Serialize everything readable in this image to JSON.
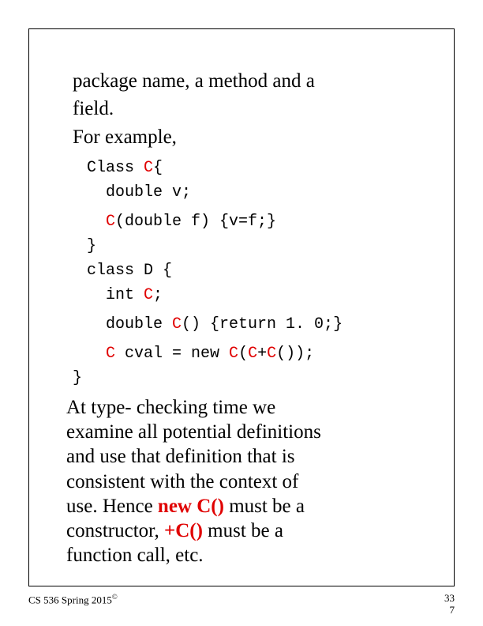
{
  "para1_line1": "package name, a method and a",
  "para1_line2": "field.",
  "para1_line3": "For example,",
  "code": {
    "l1a": "Class ",
    "l1b": "C",
    "l1c": "{",
    "l2": "double v;",
    "l3a": "C",
    "l3b": "(double f) {v=f;}",
    "l4": "}",
    "l5": "class D {",
    "l6a": "int ",
    "l6b": "C",
    "l6c": ";",
    "l7a": "double ",
    "l7b": "C",
    "l7c": "() {return 1. 0;}",
    "l8a": "C",
    "l8b": " cval = ",
    "l8c": "new ",
    "l8d": "C",
    "l8e": "(",
    "l8f": "C",
    "l8g": "+",
    "l8h": "C",
    "l8i": "());",
    "l9": "}"
  },
  "para2": {
    "l1": " At type- checking time we",
    "l2": "examine all potential definitions",
    "l3": "and use that definition that is",
    "l4": "consistent with the context of",
    "l5a": "use. Hence ",
    "l5b": "new C()",
    "l5c": " must be a",
    "l6a": "constructor, ",
    "l6b": "+C()",
    "l6c": " must be a",
    "l7": "function call, etc."
  },
  "footer": {
    "left_a": "CS 536  Spring 2015",
    "left_b": "©",
    "right_top": "33",
    "right_bottom": "7"
  }
}
